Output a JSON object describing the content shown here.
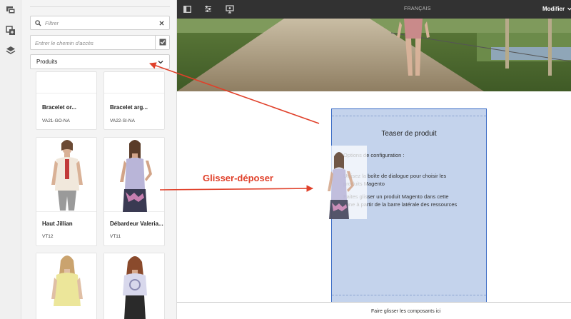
{
  "rail": {
    "icons": [
      "assets-icon",
      "components-icon",
      "layers-icon"
    ]
  },
  "panel": {
    "filter_placeholder": "Filtrer",
    "path_placeholder": "Entrer le chemin d'accès",
    "category": "Produits"
  },
  "products": [
    {
      "name": "Bracelet or...",
      "sku": "VA21-GO-NA"
    },
    {
      "name": "Bracelet arg...",
      "sku": "VA22-SI-NA"
    },
    {
      "name": "Haut Jillian",
      "sku": "VT12"
    },
    {
      "name": "Débardeur Valeria...",
      "sku": "VT11"
    },
    {
      "name": "",
      "sku": ""
    },
    {
      "name": "",
      "sku": ""
    }
  ],
  "topbar": {
    "language": "FRANÇAIS",
    "mode": "Modifier"
  },
  "teaser": {
    "title": "Teaser de produit",
    "options": "Options de configuration :",
    "line1a": "Utilisez la boîte de dialogue pour choisir les",
    "line1b": "produits Magento",
    "line2a": "Faites glisser un produit Magento dans cette",
    "line2b": "zone à partir de la barre latérale des ressources"
  },
  "drop_hint": "Faire glisser les composants ici",
  "annotation": {
    "label": "Glisser-déposer",
    "color": "#e0402a"
  },
  "colors": {
    "teaser_fill": "#c4d3ec",
    "teaser_border": "#3a6bc5",
    "topbar": "#323232"
  }
}
